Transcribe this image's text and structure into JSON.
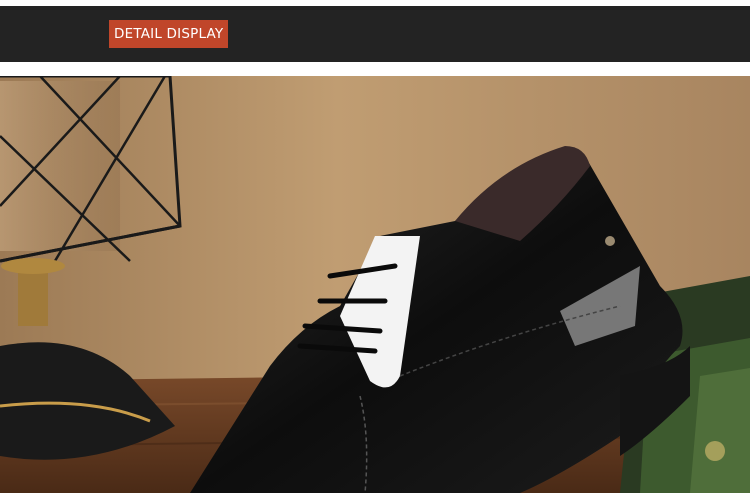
{
  "header": {
    "badge_label": "DETAIL DISPLAY"
  },
  "photo": {
    "subject": "black-patent-leather-oxford-shoe"
  },
  "colors": {
    "band": "#232323",
    "badge": "#c0462a",
    "wall": "#b8936a",
    "table": "#6a3f23"
  }
}
